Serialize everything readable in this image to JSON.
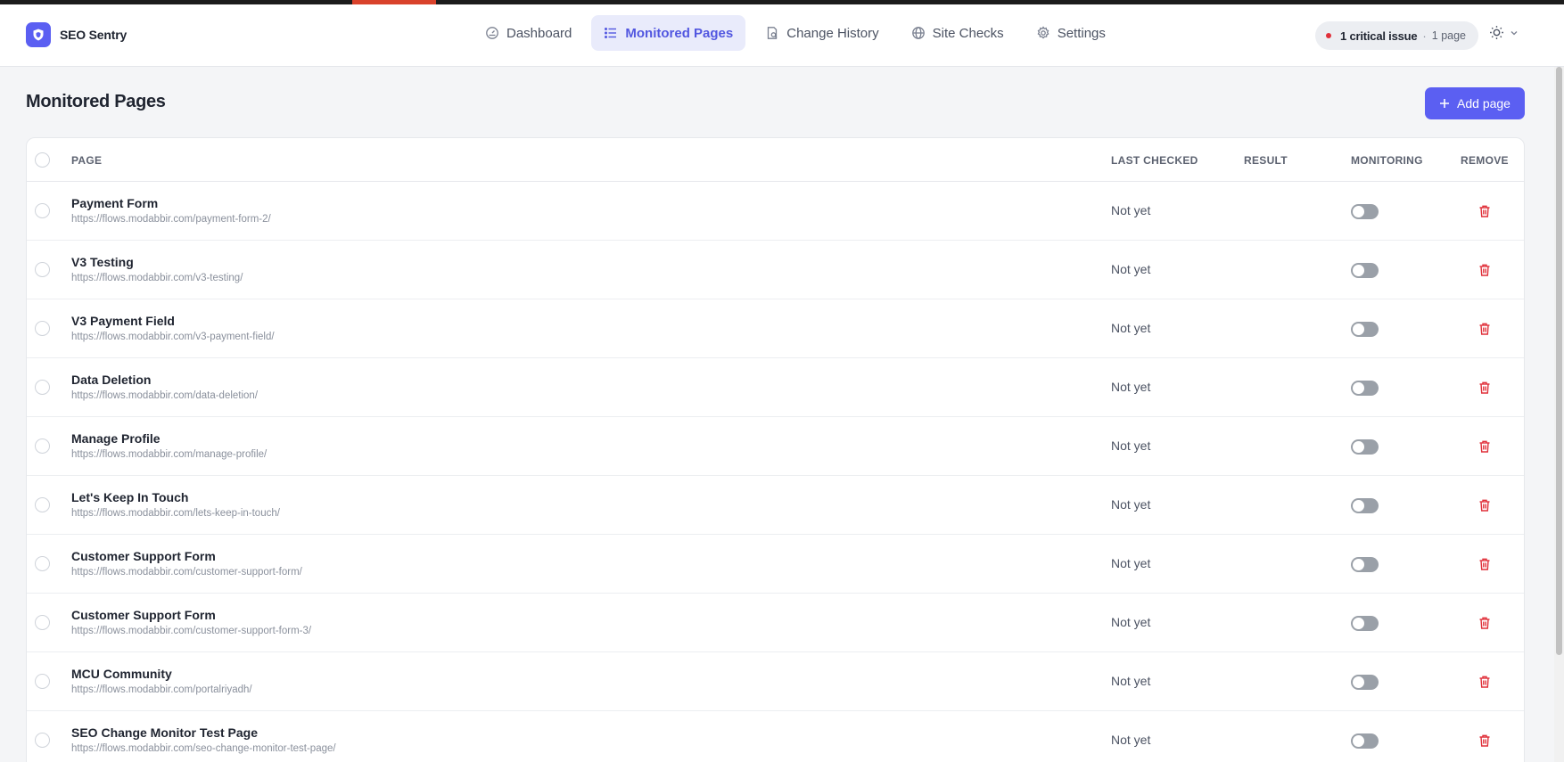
{
  "app": {
    "name": "SEO Sentry",
    "icon": "shield-icon",
    "accent_color": "#5b5ff2",
    "danger_color": "#e0303a"
  },
  "nav": {
    "items": [
      {
        "label": "Dashboard",
        "icon": "dashboard-gauge-icon",
        "active": false
      },
      {
        "label": "Monitored Pages",
        "icon": "list-icon",
        "active": true
      },
      {
        "label": "Change History",
        "icon": "history-file-icon",
        "active": false
      },
      {
        "label": "Site Checks",
        "icon": "globe-icon",
        "active": false
      },
      {
        "label": "Settings",
        "icon": "gear-icon",
        "active": false
      }
    ]
  },
  "status": {
    "critical": "1 critical issue",
    "separator": "·",
    "pages": "1 page"
  },
  "theme": {
    "icon": "sun-icon",
    "caret": "chevron-down-icon"
  },
  "main": {
    "title": "Monitored Pages",
    "add_button": "Add page"
  },
  "table": {
    "columns": {
      "page": "PAGE",
      "last_checked": "LAST CHECKED",
      "result": "RESULT",
      "monitoring": "MONITORING",
      "remove": "REMOVE"
    },
    "rows": [
      {
        "name": "Payment Form",
        "url": "https://flows.modabbir.com/payment-form-2/",
        "last_checked": "Not yet",
        "result": "",
        "monitoring": false
      },
      {
        "name": "V3 Testing",
        "url": "https://flows.modabbir.com/v3-testing/",
        "last_checked": "Not yet",
        "result": "",
        "monitoring": false
      },
      {
        "name": "V3 Payment Field",
        "url": "https://flows.modabbir.com/v3-payment-field/",
        "last_checked": "Not yet",
        "result": "",
        "monitoring": false
      },
      {
        "name": "Data Deletion",
        "url": "https://flows.modabbir.com/data-deletion/",
        "last_checked": "Not yet",
        "result": "",
        "monitoring": false
      },
      {
        "name": "Manage Profile",
        "url": "https://flows.modabbir.com/manage-profile/",
        "last_checked": "Not yet",
        "result": "",
        "monitoring": false
      },
      {
        "name": "Let's Keep In Touch",
        "url": "https://flows.modabbir.com/lets-keep-in-touch/",
        "last_checked": "Not yet",
        "result": "",
        "monitoring": false
      },
      {
        "name": "Customer Support Form",
        "url": "https://flows.modabbir.com/customer-support-form/",
        "last_checked": "Not yet",
        "result": "",
        "monitoring": false
      },
      {
        "name": "Customer Support Form",
        "url": "https://flows.modabbir.com/customer-support-form-3/",
        "last_checked": "Not yet",
        "result": "",
        "monitoring": false
      },
      {
        "name": "MCU Community",
        "url": "https://flows.modabbir.com/portalriyadh/",
        "last_checked": "Not yet",
        "result": "",
        "monitoring": false
      },
      {
        "name": "SEO Change Monitor Test Page",
        "url": "https://flows.modabbir.com/seo-change-monitor-test-page/",
        "last_checked": "Not yet",
        "result": "",
        "monitoring": false
      }
    ]
  }
}
